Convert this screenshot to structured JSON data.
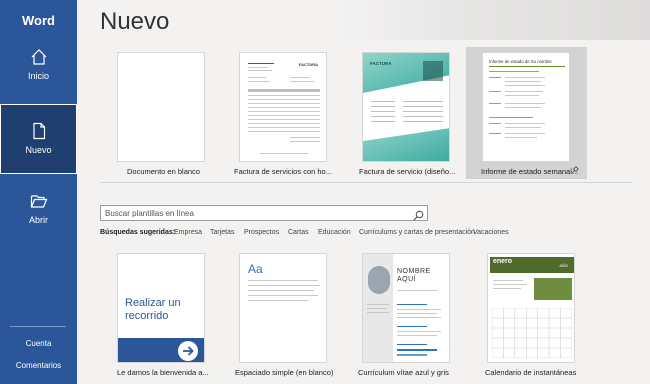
{
  "app": {
    "name": "Word"
  },
  "sidebar": {
    "items": [
      {
        "label": "Inicio",
        "icon": "home-icon"
      },
      {
        "label": "Nuevo",
        "icon": "new-document-icon"
      },
      {
        "label": "Abrir",
        "icon": "folder-open-icon"
      }
    ],
    "bottom": [
      {
        "label": "Cuenta"
      },
      {
        "label": "Comentarios"
      }
    ]
  },
  "page": {
    "title": "Nuevo"
  },
  "featured": [
    {
      "label": "Documento en blanco"
    },
    {
      "label": "Factura de servicios con ho..."
    },
    {
      "label": "Factura de servicio (diseño..."
    },
    {
      "label": "Informe de estado semanal...",
      "pinned": true
    }
  ],
  "thumb_text": {
    "invoice1_title": "FACTURA",
    "invoice2_title": "FACTURA",
    "report_title": "Informe de estado de Su nombre"
  },
  "search": {
    "placeholder": "Buscar plantillas en línea"
  },
  "suggestions": {
    "label": "Búsquedas sugeridas:",
    "items": [
      "Empresa",
      "Tarjetas",
      "Prospectos",
      "Cartas",
      "Educación",
      "Currículums y cartas de presentación",
      "Vacaciones"
    ]
  },
  "templates": [
    {
      "label": "Le damos la bienvenida a...",
      "thumb_title": "Realizar un recorrido"
    },
    {
      "label": "Espaciado simple (en blanco)",
      "thumb_title": "Aa"
    },
    {
      "label": "Currículum vítae azul y gris",
      "thumb_title": "NOMBRE AQUÍ"
    },
    {
      "label": "Calendario de instantáneas",
      "thumb_title": "enero",
      "thumb_year": "AÑO"
    }
  ],
  "colors": {
    "sidebar": "#2b579a",
    "sidebar_active": "#1f3f70",
    "accent_blue": "#2b579a",
    "teal": "#5ab9a8",
    "report_green": "#5b8c2a",
    "calendar_green": "#4f6a2a"
  }
}
